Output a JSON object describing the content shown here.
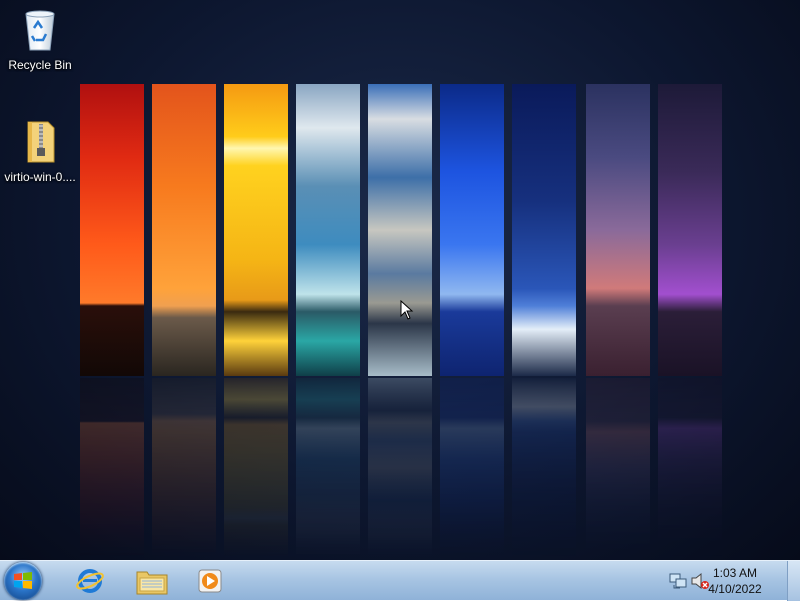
{
  "desktop": {
    "icons": [
      {
        "label": "Recycle Bin",
        "icon": "recycle-bin-icon"
      },
      {
        "label": "virtio-win-0....",
        "icon": "zip-folder-icon"
      }
    ],
    "wallpaper_colors": [
      "#e02a12",
      "#f77a1e",
      "#ffcc1a",
      "#3e8cbf",
      "#3d6fa8",
      "#1d54e0",
      "#16307e",
      "#8a6a9a",
      "#6a3f90"
    ]
  },
  "taskbar": {
    "start_icon": "windows-orb-icon",
    "pinned": [
      {
        "name": "Internet Explorer",
        "icon": "internet-explorer-icon"
      },
      {
        "name": "Windows Explorer",
        "icon": "file-explorer-icon"
      },
      {
        "name": "Windows Media Player",
        "icon": "media-player-icon"
      }
    ],
    "tray": {
      "network_icon": "network-icon",
      "volume_icon": "volume-muted-icon"
    },
    "clock": {
      "time": "1:03 AM",
      "date": "4/10/2022"
    }
  }
}
